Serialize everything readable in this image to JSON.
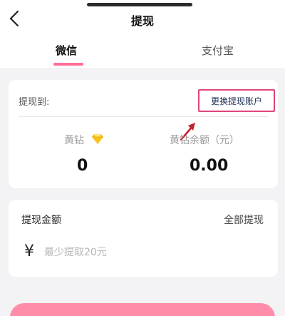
{
  "header": {
    "title": "提现",
    "back_icon": "chevron-left-icon"
  },
  "tabs": [
    {
      "label": "微信",
      "active": true
    },
    {
      "label": "支付宝",
      "active": false
    }
  ],
  "account": {
    "withdraw_to_label": "提现到:",
    "change_account_label": "更换提现账户",
    "stats": [
      {
        "label": "黄钻",
        "icon": "diamond-icon",
        "value": "0"
      },
      {
        "label": "黄钻余额（元）",
        "value": "0.00"
      }
    ]
  },
  "amount": {
    "title": "提现金额",
    "withdraw_all_label": "全部提现",
    "currency_symbol": "¥",
    "placeholder": "最少提取20元"
  },
  "colors": {
    "accent": "#ff6f95",
    "highlight_box": "#e0457b",
    "diamond": "#f6c31a",
    "annotation_arrow": "#c3212b"
  }
}
